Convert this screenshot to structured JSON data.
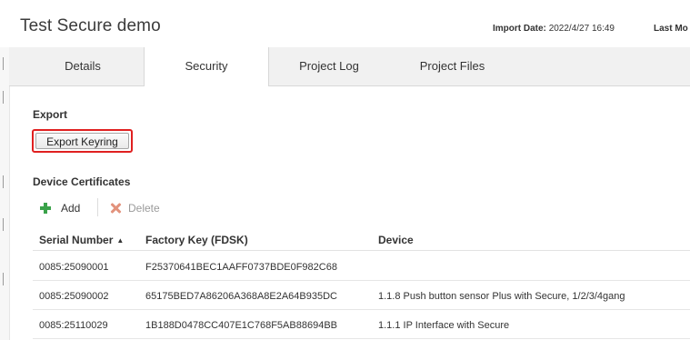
{
  "window": {
    "title": "Test  Secure demo"
  },
  "meta": {
    "import_label": "Import Date:",
    "import_value": "2022/4/27 16:49",
    "last_label": "Last Mo"
  },
  "tabs": [
    {
      "label": "Details",
      "active": false
    },
    {
      "label": "Security",
      "active": true
    },
    {
      "label": "Project Log",
      "active": false
    },
    {
      "label": "Project Files",
      "active": false
    }
  ],
  "export": {
    "section_label": "Export",
    "button_label": "Export Keyring"
  },
  "certificates": {
    "section_label": "Device Certificates",
    "add_label": "Add",
    "delete_label": "Delete",
    "columns": [
      {
        "label": "Serial Number",
        "sort": "ascending"
      },
      {
        "label": "Factory Key (FDSK)"
      },
      {
        "label": "Device"
      }
    ],
    "rows": [
      {
        "serial": "0085:25090001",
        "fdsk": "F25370641BEC1AAFF0737BDE0F982C68",
        "device": ""
      },
      {
        "serial": "0085:25090002",
        "fdsk": "65175BED7A86206A368A8E2A64B935DC",
        "device": "1.1.8 Push button sensor Plus with Secure, 1/2/3/4gang"
      },
      {
        "serial": "0085:25110029",
        "fdsk": "1B188D0478CC407E1C768F5AB88694BB",
        "device": "1.1.1 IP Interface with Secure"
      }
    ]
  },
  "icons": {
    "sort": "▲"
  },
  "colors": {
    "highlight": "#e02020",
    "add": "#3aa24a",
    "delete": "#e2927c"
  }
}
